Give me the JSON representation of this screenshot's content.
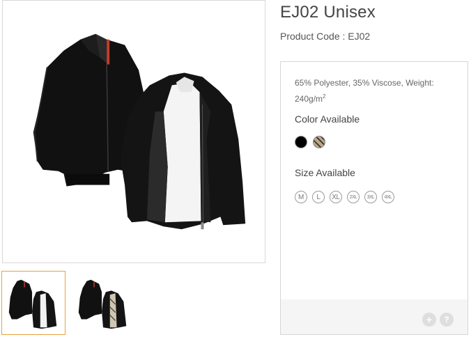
{
  "product": {
    "title": "EJ02 Unisex",
    "code_label": "Product Code : EJ02"
  },
  "gallery": {
    "main_image": "black-jacket-pair-image",
    "thumbnails": [
      "jacket-pair-thumbnail",
      "jacket-pair-thumbnail-alt"
    ]
  },
  "details": {
    "material_text": "65% Polyester, 35% Viscose, Weight: 240g/m",
    "material_sup": "2",
    "color_title": "Color Available",
    "colors": [
      {
        "name": "black",
        "hex": "#000000"
      },
      {
        "name": "pattern",
        "hex": "#bca889"
      }
    ],
    "size_title": "Size Available",
    "sizes": [
      "M",
      "L",
      "XL",
      "2XL",
      "3XL",
      "4XL"
    ]
  },
  "footer": {
    "plus_label": "+",
    "help_label": "?"
  }
}
